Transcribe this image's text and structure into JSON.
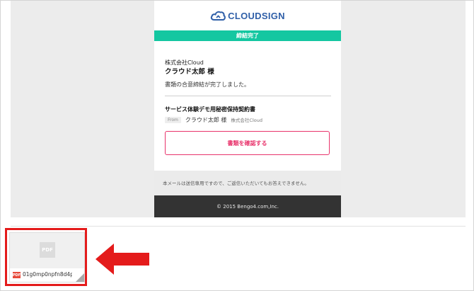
{
  "email": {
    "brand": "CLOUDSIGN",
    "status": "締結完了",
    "company": "株式会社Cloud",
    "recipient": "クラウド太郎 様",
    "message": "書類の合意締結が完了しました。",
    "document_title": "サービス体験デモ用秘密保持契約書",
    "from_label": "From",
    "from_name": "クラウド太郎 様",
    "from_company": "株式会社Cloud",
    "confirm_button": "書類を確認する",
    "notice": "本メールは送信専用ですので、ご返信いただいてもお答えできません。",
    "footer": "© 2015 Bengo4.com,Inc."
  },
  "attachment": {
    "thumbnail_label": "PDF",
    "type_badge": "PDF",
    "file_name": "01g0mp0npfn8d4p..."
  },
  "colors": {
    "brand_blue": "#2f5fa8",
    "status_green": "#14c7a1",
    "button_pink": "#e8336b",
    "highlight_red": "#e41b1b"
  }
}
